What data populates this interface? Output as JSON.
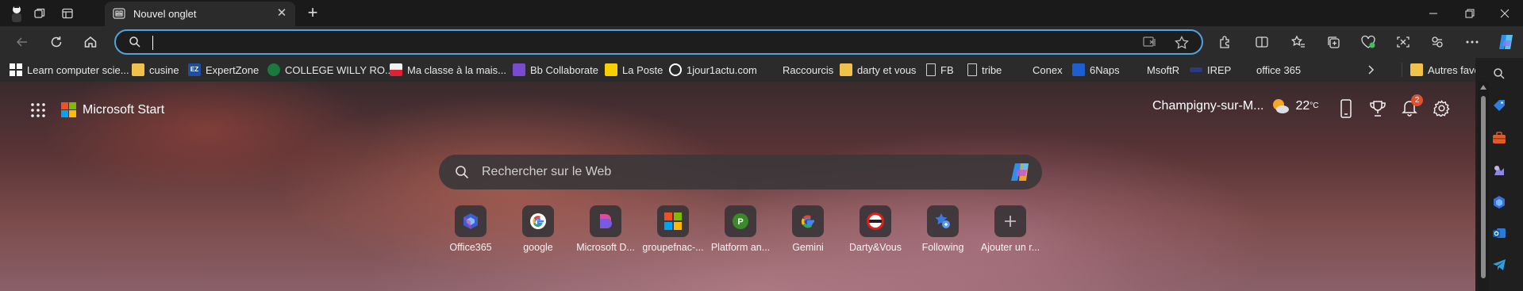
{
  "tab": {
    "title": "Nouvel onglet"
  },
  "address_bar": {
    "value": "",
    "placeholder": ""
  },
  "bookmarks": [
    {
      "label": "Learn computer scie...",
      "icon": "grid-icon"
    },
    {
      "label": "cusine",
      "icon": "folder-icon"
    },
    {
      "label": "ExpertZone",
      "icon": "ez-icon"
    },
    {
      "label": "COLLEGE WILLY RO...",
      "icon": "college-icon"
    },
    {
      "label": "Ma classe à la mais...",
      "icon": "classroom-icon"
    },
    {
      "label": "Bb Collaborate",
      "icon": "collaborate-icon"
    },
    {
      "label": "La Poste",
      "icon": "mail-icon"
    },
    {
      "label": "1jour1actu.com",
      "icon": "news-icon"
    },
    {
      "label": "Raccourcis",
      "icon": "microsoft-icon"
    },
    {
      "label": "darty et vous",
      "icon": "folder-icon"
    },
    {
      "label": "FB",
      "icon": "page-icon"
    },
    {
      "label": "tribe",
      "icon": "page-icon"
    },
    {
      "label": "Conex",
      "icon": "microsoft-icon"
    },
    {
      "label": "6Naps",
      "icon": "naps-icon"
    },
    {
      "label": "MsoftR",
      "icon": "microsoft-icon"
    },
    {
      "label": "IREP",
      "icon": "irep-icon"
    },
    {
      "label": "office 365",
      "icon": "microsoft-icon"
    }
  ],
  "other_favorites": "Autres favoris",
  "start": {
    "brand": "Microsoft Start",
    "location": "Champigny-sur-M...",
    "temperature": "22",
    "temp_unit": "°C",
    "notification_count": "2",
    "search_placeholder": "Rechercher sur le Web"
  },
  "quick_links": [
    {
      "label": "Office365",
      "icon": "office365-icon"
    },
    {
      "label": "google",
      "icon": "google-icon"
    },
    {
      "label": "Microsoft D...",
      "icon": "microsoft-designer-icon"
    },
    {
      "label": "groupefnac-...",
      "icon": "microsoft-icon"
    },
    {
      "label": "Platform an...",
      "icon": "platform-icon"
    },
    {
      "label": "Gemini",
      "icon": "google-icon"
    },
    {
      "label": "Darty&Vous",
      "icon": "darty-icon"
    },
    {
      "label": "Following",
      "icon": "following-icon"
    },
    {
      "label": "Ajouter un r...",
      "icon": "plus-icon"
    }
  ],
  "colors": {
    "accent": "#4fa3e0",
    "badge": "#e0502e"
  }
}
